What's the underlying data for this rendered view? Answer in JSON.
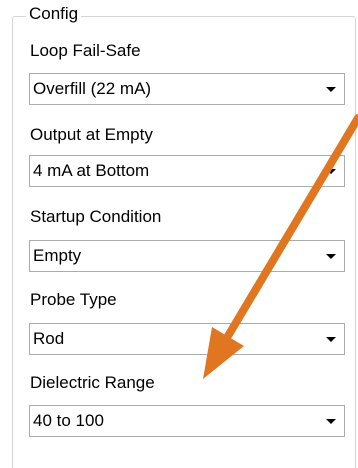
{
  "group": {
    "title": "Config"
  },
  "fields": [
    {
      "label": "Loop Fail-Safe",
      "value": "Overfill (22 mA)"
    },
    {
      "label": "Output at Empty",
      "value": "4 mA at Bottom"
    },
    {
      "label": "Startup Condition",
      "value": "Empty"
    },
    {
      "label": "Probe Type",
      "value": "Rod"
    },
    {
      "label": "Dielectric Range",
      "value": "40 to 100"
    }
  ],
  "icons": {
    "dropdown": "chevron-down-icon",
    "annotation": "arrow-annotation"
  },
  "colors": {
    "annotation_arrow": "#e0761f",
    "group_border": "#d6d6d6",
    "combo_border": "#ababab"
  }
}
